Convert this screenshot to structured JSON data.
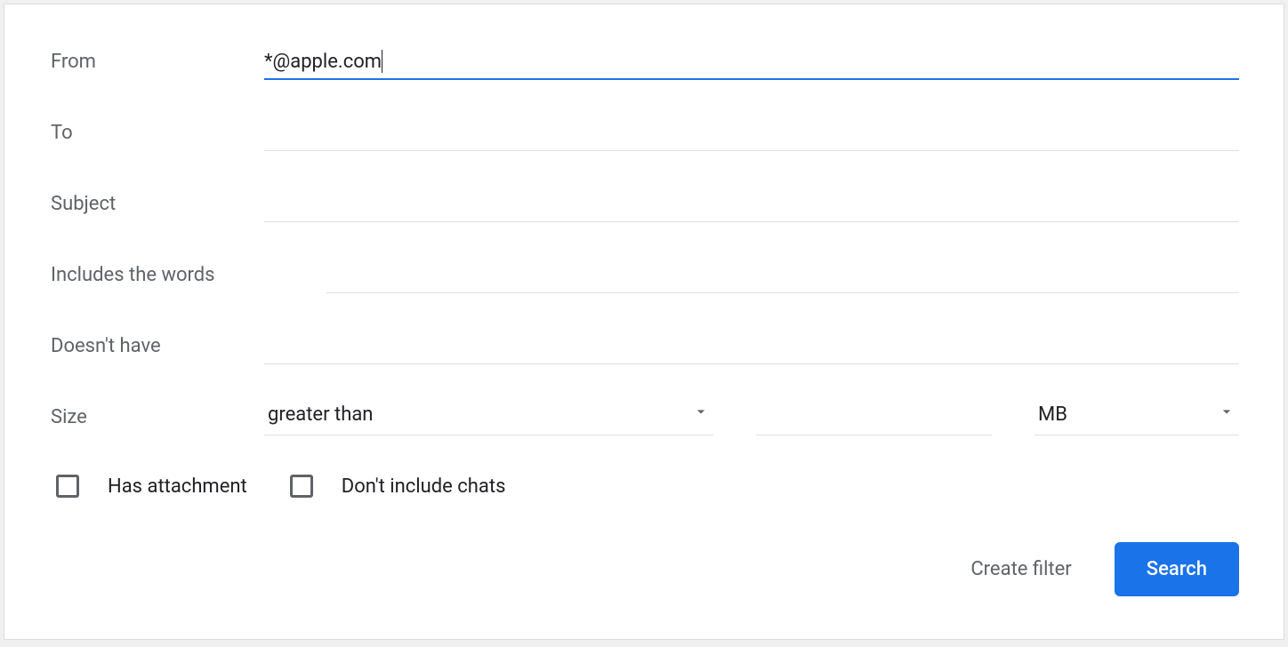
{
  "form": {
    "from_label": "From",
    "from_value": "*@apple.com",
    "to_label": "To",
    "to_value": "",
    "subject_label": "Subject",
    "subject_value": "",
    "includes_label": "Includes the words",
    "includes_value": "",
    "doesnt_have_label": "Doesn't have",
    "doesnt_have_value": "",
    "size_label": "Size",
    "size_comparator": "greater than",
    "size_value": "",
    "size_unit": "MB",
    "has_attachment_label": "Has attachment",
    "dont_include_chats_label": "Don't include chats"
  },
  "footer": {
    "create_filter_label": "Create filter",
    "search_label": "Search"
  }
}
